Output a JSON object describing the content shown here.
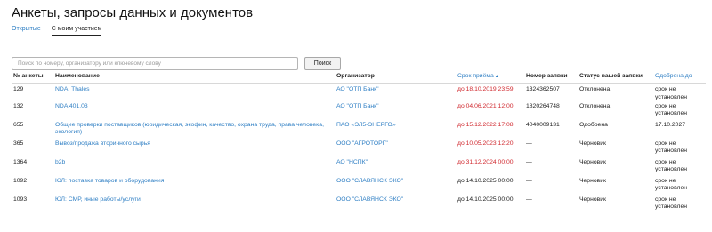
{
  "page": {
    "title": "Анкеты, запросы данных и документов"
  },
  "tabs": [
    {
      "label": "Открытые"
    },
    {
      "label": "С моим участием"
    }
  ],
  "search": {
    "placeholder": "Поиск по номеру, организатору или ключевому слову",
    "value": "",
    "button_label": "Поиск"
  },
  "table": {
    "headers": {
      "number": "№ анкеты",
      "name": "Наименование",
      "organizer": "Организатор",
      "deadline": "Срок приёма",
      "deadline_sort_icon": "sort-ascending-icon",
      "request_no": "Номер заявки",
      "status": "Статус вашей заявки",
      "approved_until": "Одобрена до"
    },
    "rows": [
      {
        "number": "129",
        "name": "NDA_Thales",
        "organizer": "АО \"ОТП Банк\"",
        "deadline": "до 18.10.2019 23:59",
        "deadline_overdue": true,
        "request_no": "1324362507",
        "status": "Отклонена",
        "approved_until": "срок не установлен"
      },
      {
        "number": "132",
        "name": "NDA 401.03",
        "organizer": "АО \"ОТП Банк\"",
        "deadline": "до 04.06.2021 12:00",
        "deadline_overdue": true,
        "request_no": "1820264748",
        "status": "Отклонена",
        "approved_until": "срок не установлен"
      },
      {
        "number": "655",
        "name": "Общие проверки поставщиков (юридическая, экофин, качество, охрана труда, права человека, экология)",
        "organizer": "ПАО «ЭЛ5-ЭНЕРГО»",
        "deadline": "до 15.12.2022 17:08",
        "deadline_overdue": true,
        "request_no": "4040009131",
        "status": "Одобрена",
        "approved_until": "17.10.2027"
      },
      {
        "number": "365",
        "name": "Вывоз/продажа вторичного сырья",
        "organizer": "ООО \"АГРОТОРГ\"",
        "deadline": "до 10.05.2023 12:20",
        "deadline_overdue": true,
        "request_no": "—",
        "status": "Черновик",
        "approved_until": "срок не установлен"
      },
      {
        "number": "1364",
        "name": "b2b",
        "organizer": "АО \"НСПК\"",
        "deadline": "до 31.12.2024 00:00",
        "deadline_overdue": true,
        "request_no": "—",
        "status": "Черновик",
        "approved_until": "срок не установлен"
      },
      {
        "number": "1092",
        "name": "ЮЛ: поставка товаров и оборудования",
        "organizer": "ООО \"СЛАВЯНСК ЭКО\"",
        "deadline": "до 14.10.2025 00:00",
        "deadline_overdue": false,
        "request_no": "—",
        "status": "Черновик",
        "approved_until": "срок не установлен"
      },
      {
        "number": "1093",
        "name": "ЮЛ: СМР, иные работы/услуги",
        "organizer": "ООО \"СЛАВЯНСК ЭКО\"",
        "deadline": "до 14.10.2025 00:00",
        "deadline_overdue": false,
        "request_no": "—",
        "status": "Черновик",
        "approved_until": "срок не установлен"
      }
    ]
  },
  "colors": {
    "link": "#2f7fc4",
    "overdue": "#d0282e",
    "text": "#222222"
  }
}
